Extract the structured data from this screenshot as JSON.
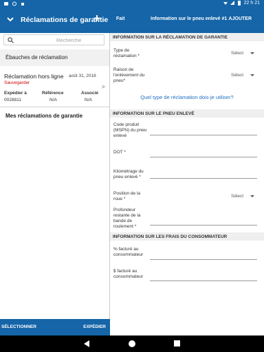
{
  "status_bar": {
    "time": "22 h 21"
  },
  "left_header": {
    "title": "Réclamations de garantie",
    "add_icon": "+"
  },
  "right_header": {
    "done_label": "Fait",
    "title": "Information sur le pneu enlevé #1",
    "add_label": "AJOUTER"
  },
  "search": {
    "placeholder": "Recherche"
  },
  "drafts": {
    "heading": "Ébauches de réclamation",
    "items": [
      {
        "name": "Réclamation hors ligne",
        "date": "août 31, 2018",
        "status": "Sauvegarder",
        "columns": [
          {
            "header": "Expédier à",
            "value": "0028811"
          },
          {
            "header": "Référence",
            "value": "N/A"
          },
          {
            "header": "Associé",
            "value": "N/A"
          }
        ]
      }
    ]
  },
  "my_claims_heading": "Mes réclamations de garantie",
  "left_footer": {
    "select_label": "SÉLECTIONNER",
    "ship_label": "EXPÉDIER"
  },
  "form": {
    "section1": {
      "heading": "INFORMATION SUR LA RÉCLAMATION DE GARANTIE",
      "claim_type_label": "Type de réclamation *",
      "claim_type_value": "Sélect",
      "removal_reason_label": "Raison de l'enlèvement du pneu*",
      "removal_reason_value": "Sélect",
      "help_link": "Quel type de réclamation dois-je utiliser?"
    },
    "section2": {
      "heading": "INFORMATION SUR LE PNEU ENLEVÉ",
      "product_code_label": "Code produit (MSPN) du pneu enlevé",
      "dot_label": "DOT *",
      "mileage_label": "Kilométrage du pneu enlevé *",
      "wheel_position_label": "Position de la roue *",
      "wheel_position_value": "Sélect",
      "tread_depth_label": "Profondeur restante de la bande de roulement *"
    },
    "section3": {
      "heading": "INFORMATION SUR LES FRAIS DU CONSOMMATEUR",
      "percent_billed_label": "% facturé au consommateur",
      "dollar_billed_label": "$ facturé au consommateur"
    }
  },
  "colors": {
    "primary": "#1565a8",
    "accent": "#f5d21c",
    "warning": "#d30000",
    "link": "#1e6fc4"
  }
}
